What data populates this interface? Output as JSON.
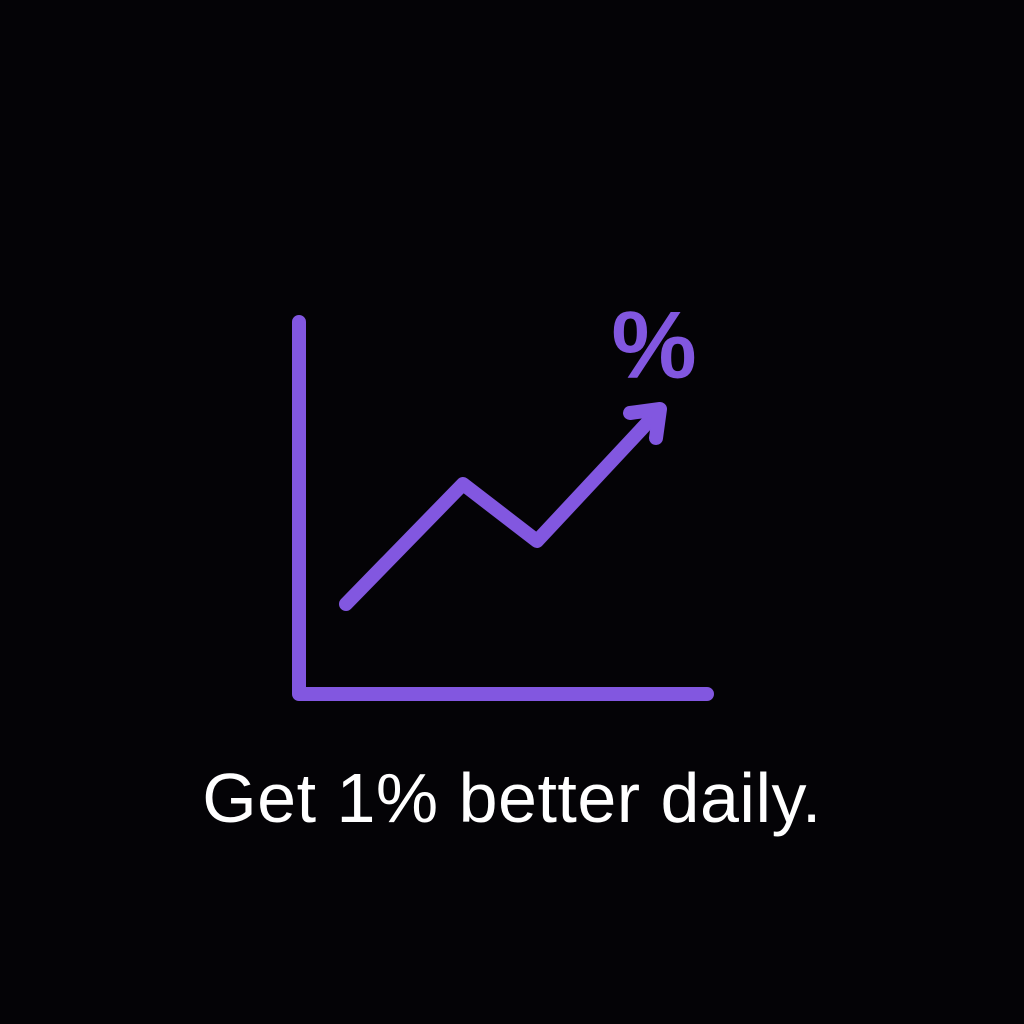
{
  "colors": {
    "background": "#040306",
    "accent": "#8257E0",
    "text": "#FFFFFF"
  },
  "icon": {
    "name": "growth-chart-percent-icon",
    "symbol": "%"
  },
  "tagline": "Get 1% better daily."
}
